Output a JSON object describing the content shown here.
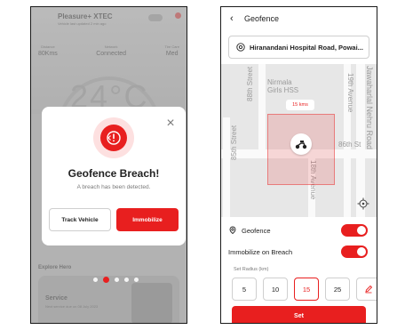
{
  "left": {
    "bg_title": "Pleasure+ XTEC",
    "bg_subtitle": "Vehicle last updated 2 min ago",
    "bg_stats": [
      {
        "label": "Distance",
        "value": "80Kms"
      },
      {
        "label": "Network",
        "value": "Connected"
      },
      {
        "label": "Tire Care",
        "value": "Med"
      }
    ],
    "bg_temperature": "24°C",
    "bg_explore": "Explore Hero",
    "bg_service": "Service",
    "bg_service_sub": "Next service due on 08 July 2023",
    "modal": {
      "title": "Geofence Breach!",
      "description": "A breach has been detected.",
      "track_button": "Track Vehicle",
      "immobilize_button": "Immobilize",
      "close_icon": "close-icon",
      "alert_icon": "alert-scooter-icon"
    },
    "carousel": {
      "count": 5,
      "active": 1
    }
  },
  "right": {
    "title": "Geofence",
    "location": "Hiranandani Hospital Road, Powai...",
    "map": {
      "labels": [
        "Nirmala Girls HSS",
        "88th Street",
        "19th Avenue",
        "Jawaharlal Nehru Road",
        "86th St",
        "18th Avenue",
        "85th Street"
      ],
      "fence_radius_label": "15 kms"
    },
    "geofence_toggle": {
      "label": "Geofence",
      "on": true
    },
    "immobilize_toggle": {
      "label": "Immobilize on Breach",
      "on": true
    },
    "radius_label": "Set Radius (km)",
    "radius_options": [
      "5",
      "10",
      "15",
      "25"
    ],
    "selected_radius": "15",
    "set_button": "Set",
    "colors": {
      "accent": "#e81f1f",
      "map_bg": "#e7e7e7"
    }
  }
}
